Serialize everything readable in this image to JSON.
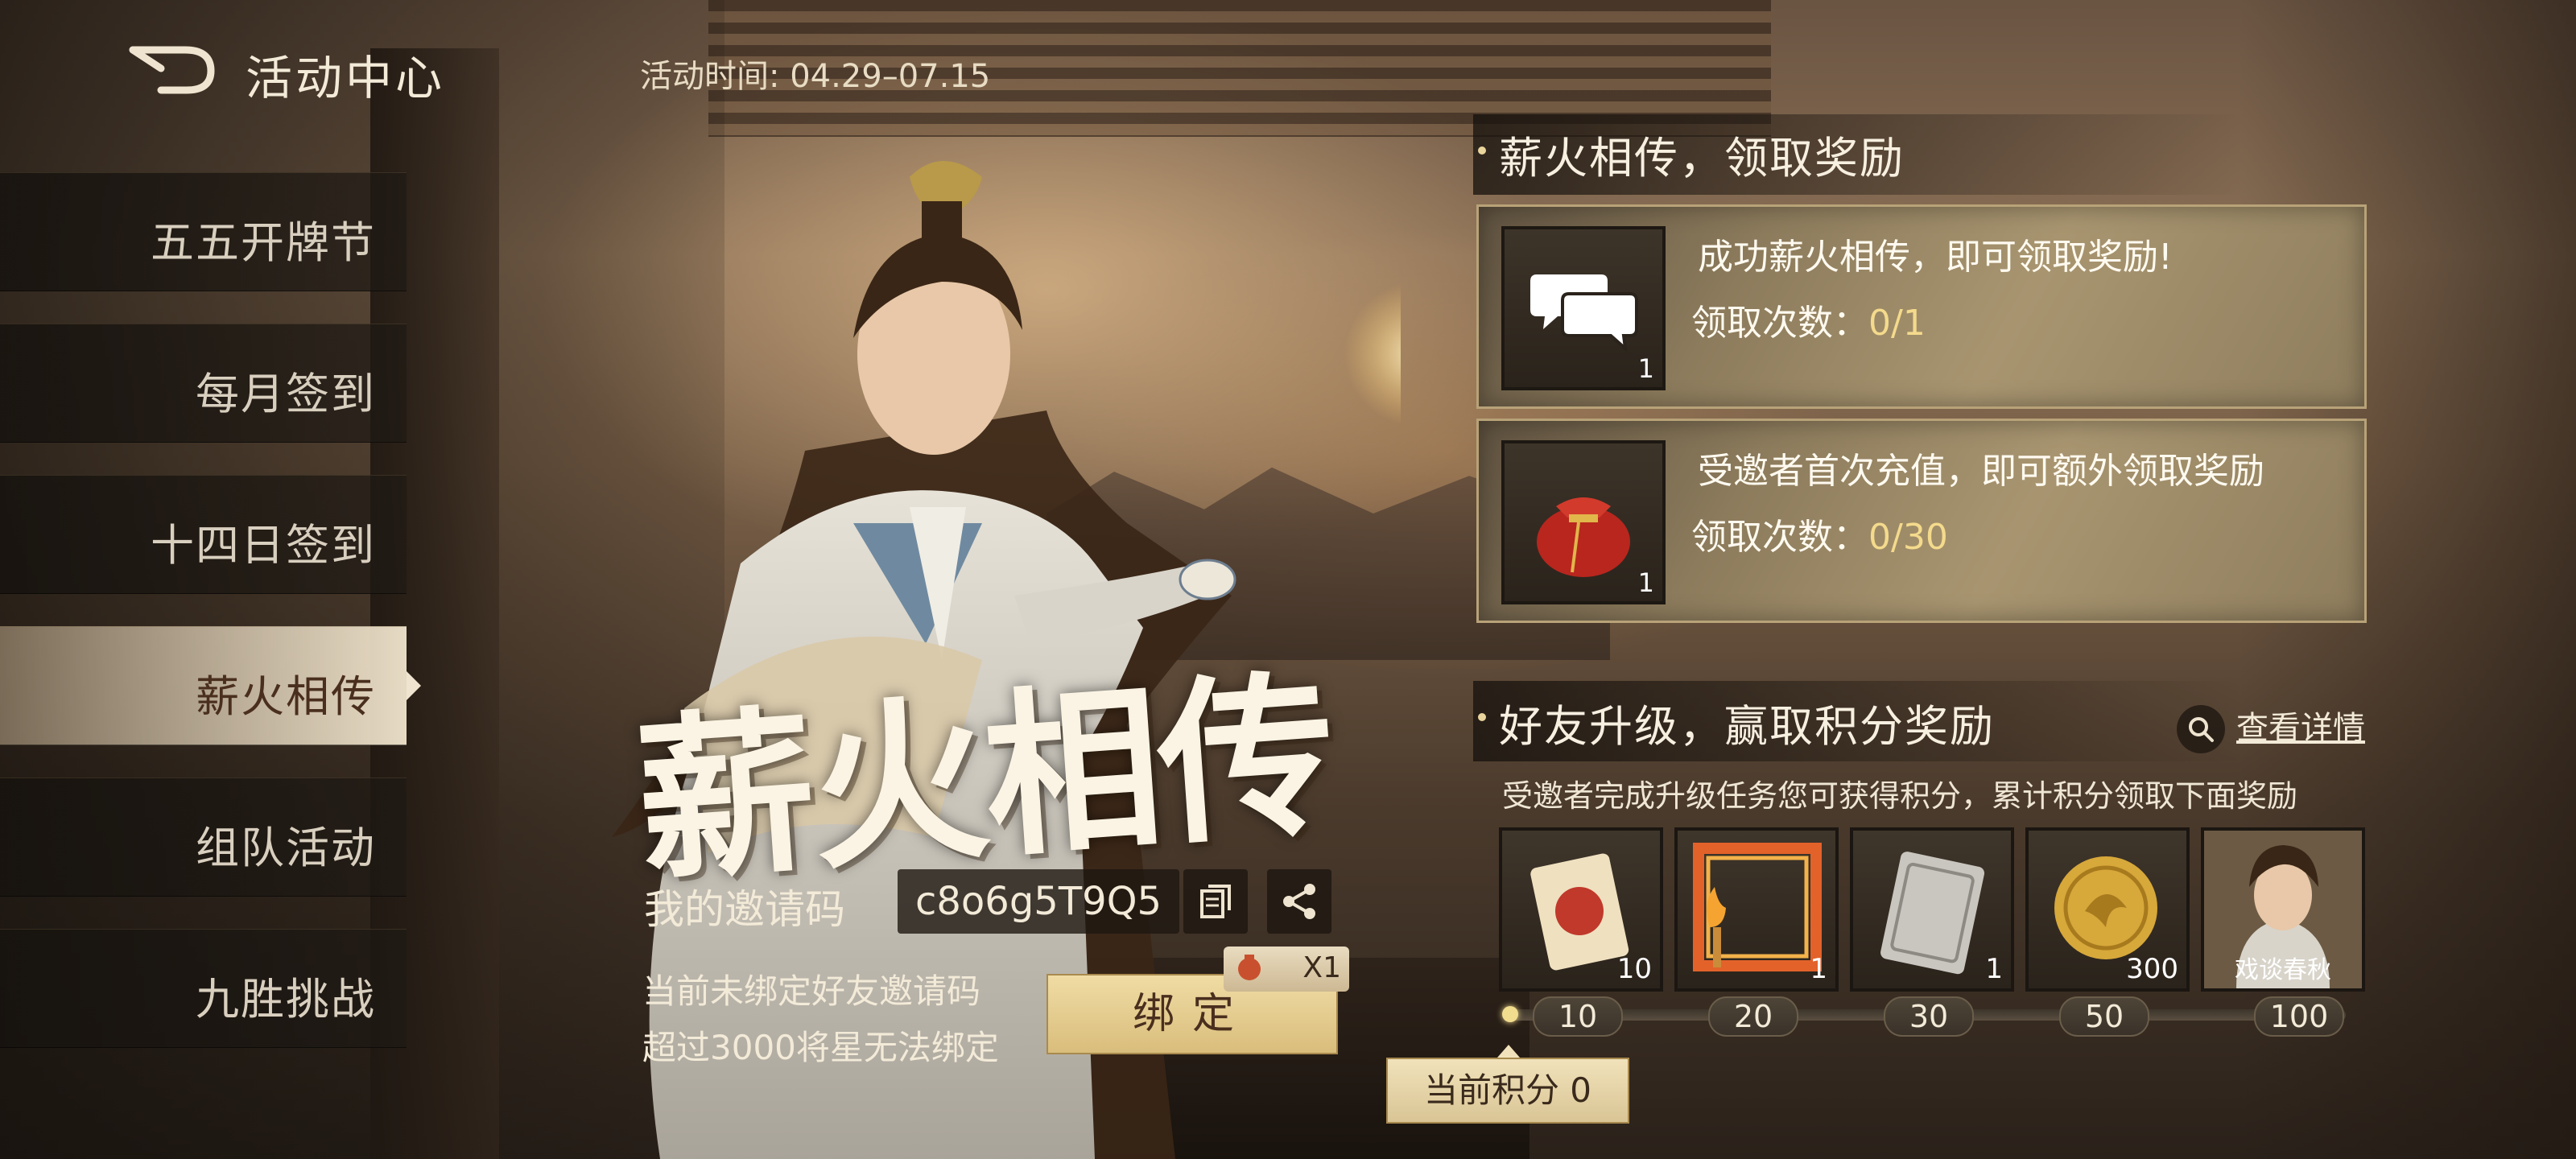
{
  "header": {
    "title": "活动中心",
    "activity_time": "活动时间: 04.29–07.15"
  },
  "sidebar": {
    "items": [
      {
        "label": "五五开牌节",
        "active": false
      },
      {
        "label": "每月签到",
        "active": false
      },
      {
        "label": "十四日签到",
        "active": false
      },
      {
        "label": "薪火相传",
        "active": true
      },
      {
        "label": "组队活动",
        "active": false
      },
      {
        "label": "九胜挑战",
        "active": false
      }
    ]
  },
  "banner": {
    "calligraphy": "薪火相传"
  },
  "invite": {
    "label": "我的邀请码",
    "code": "c8o6g5T9Q5",
    "note_line1": "当前未绑定好友邀请码",
    "note_line2": "超过3000将星无法绑定",
    "bind_button": "绑定",
    "bind_reward_count": "X1"
  },
  "section1": {
    "title": "薪火相传，领取奖励",
    "cards": [
      {
        "icon": "chat-bubbles-icon",
        "qty": "1",
        "text": "成功薪火相传，即可领取奖励!",
        "count_label": "领取次数：",
        "count_value": "0/1"
      },
      {
        "icon": "red-pouch-icon",
        "qty": "1",
        "text": "受邀者首次充值，即可额外领取奖励",
        "count_label": "领取次数：",
        "count_value": "0/30"
      }
    ]
  },
  "section2": {
    "title": "好友升级，赢取积分奖励",
    "detail_link": "查看详情",
    "description": "受邀者完成升级任务您可获得积分，累计积分领取下面奖励",
    "rewards": [
      {
        "icon": "red-card-icon",
        "qty": "10",
        "milestone": "10"
      },
      {
        "icon": "flame-frame-icon",
        "qty": "1",
        "milestone": "20"
      },
      {
        "icon": "silver-card-icon",
        "qty": "1",
        "milestone": "30"
      },
      {
        "icon": "gold-coin-icon",
        "qty": "300",
        "milestone": "50"
      },
      {
        "icon": "avatar-icon",
        "name": "戏谈春秋",
        "milestone": "100"
      }
    ],
    "current_points": "当前积分 0",
    "progress": 0
  },
  "colors": {
    "accent_gold": "#f4da8c",
    "active_tab": "#efe4cf",
    "button_gold": "#e6cf93"
  }
}
